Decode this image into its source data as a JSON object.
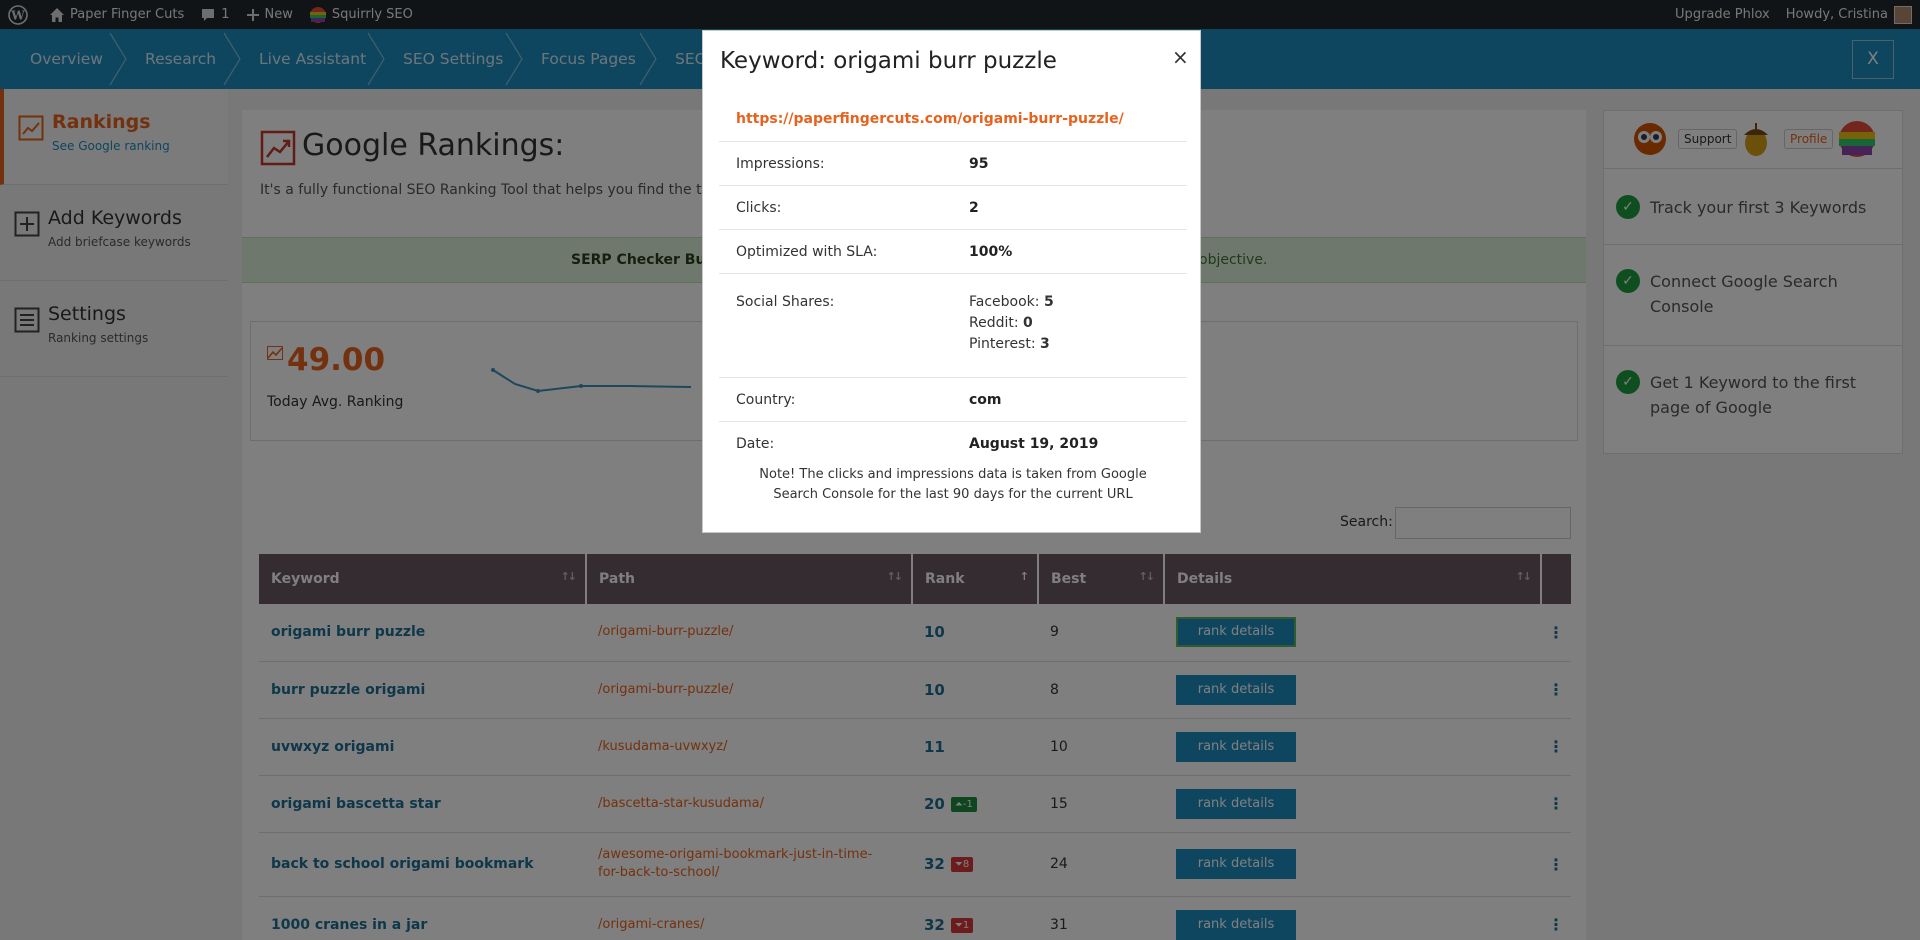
{
  "adminbar": {
    "site_name": "Paper Finger Cuts",
    "comments_count": "1",
    "new_label": "New",
    "plugin_label": "Squirrly SEO",
    "upgrade_label": "Upgrade Phlox",
    "howdy_label": "Howdy, Cristina"
  },
  "nav": {
    "items": [
      "Overview",
      "Research",
      "Live Assistant",
      "SEO Settings",
      "Focus Pages",
      "SEO"
    ],
    "close_label": "X"
  },
  "sidebar": {
    "items": [
      {
        "title": "Rankings",
        "subtitle": "See Google ranking",
        "icon": "chart-icon"
      },
      {
        "title": "Add Keywords",
        "subtitle": "Add briefcase keywords",
        "icon": "plus-box-icon"
      },
      {
        "title": "Settings",
        "subtitle": "Ranking settings",
        "icon": "sliders-icon"
      }
    ]
  },
  "main": {
    "title": "Google Rankings:",
    "description": "It's a fully functional SEO Ranking Tool that helps you find the true p",
    "serp_left": "SERP Checker Busi",
    "serp_right": "objective.",
    "avg_value": "49.00",
    "avg_label": "Today Avg. Ranking",
    "search_label": "Search:"
  },
  "table": {
    "headers": [
      "Keyword",
      "Path",
      "Rank",
      "Best",
      "Details"
    ],
    "button_label": "rank details",
    "rows": [
      {
        "keyword": "origami burr puzzle",
        "path": "/origami-burr-puzzle/",
        "rank": "10",
        "change": "",
        "dir": "",
        "best": "9"
      },
      {
        "keyword": "burr puzzle origami",
        "path": "/origami-burr-puzzle/",
        "rank": "10",
        "change": "",
        "dir": "",
        "best": "8"
      },
      {
        "keyword": "uvwxyz origami",
        "path": "/kusudama-uvwxyz/",
        "rank": "11",
        "change": "",
        "dir": "",
        "best": "10"
      },
      {
        "keyword": "origami bascetta star",
        "path": "/bascetta-star-kusudama/",
        "rank": "20",
        "change": "-1",
        "dir": "up",
        "best": "15"
      },
      {
        "keyword": "back to school origami bookmark",
        "path": "/awesome-origami-bookmark-just-in-time-for-back-to-school/",
        "rank": "32",
        "change": "8",
        "dir": "down",
        "best": "24"
      },
      {
        "keyword": "1000 cranes in a jar",
        "path": "/origami-cranes/",
        "rank": "32",
        "change": "1",
        "dir": "down",
        "best": "31"
      }
    ]
  },
  "rightpanel": {
    "support_label": "Support",
    "profile_label": "Profile",
    "tasks": [
      "Track your first 3 Keywords",
      "Connect Google Search Console",
      "Get 1 Keyword to the first page of Google"
    ]
  },
  "modal": {
    "title": "Keyword: origami burr puzzle",
    "close": "×",
    "url": "https://paperfingercuts.com/origami-burr-puzzle/",
    "impressions_label": "Impressions:",
    "impressions": "95",
    "clicks_label": "Clicks:",
    "clicks": "2",
    "optimized_label": "Optimized with SLA:",
    "optimized": "100%",
    "social_label": "Social Shares:",
    "facebook_label": "Facebook:",
    "facebook": "5",
    "reddit_label": "Reddit:",
    "reddit": "0",
    "pinterest_label": "Pinterest:",
    "pinterest": "3",
    "country_label": "Country:",
    "country": "com",
    "date_label": "Date:",
    "date": "August 19, 2019",
    "note": "Note! The clicks and impressions data is taken from Google Search Console for the last 90 days for the current URL"
  },
  "colors": {
    "accent": "#e8621d",
    "nav_blue": "#1e8cbe",
    "table_header": "#6b5863",
    "success": "#1e9e3e"
  }
}
